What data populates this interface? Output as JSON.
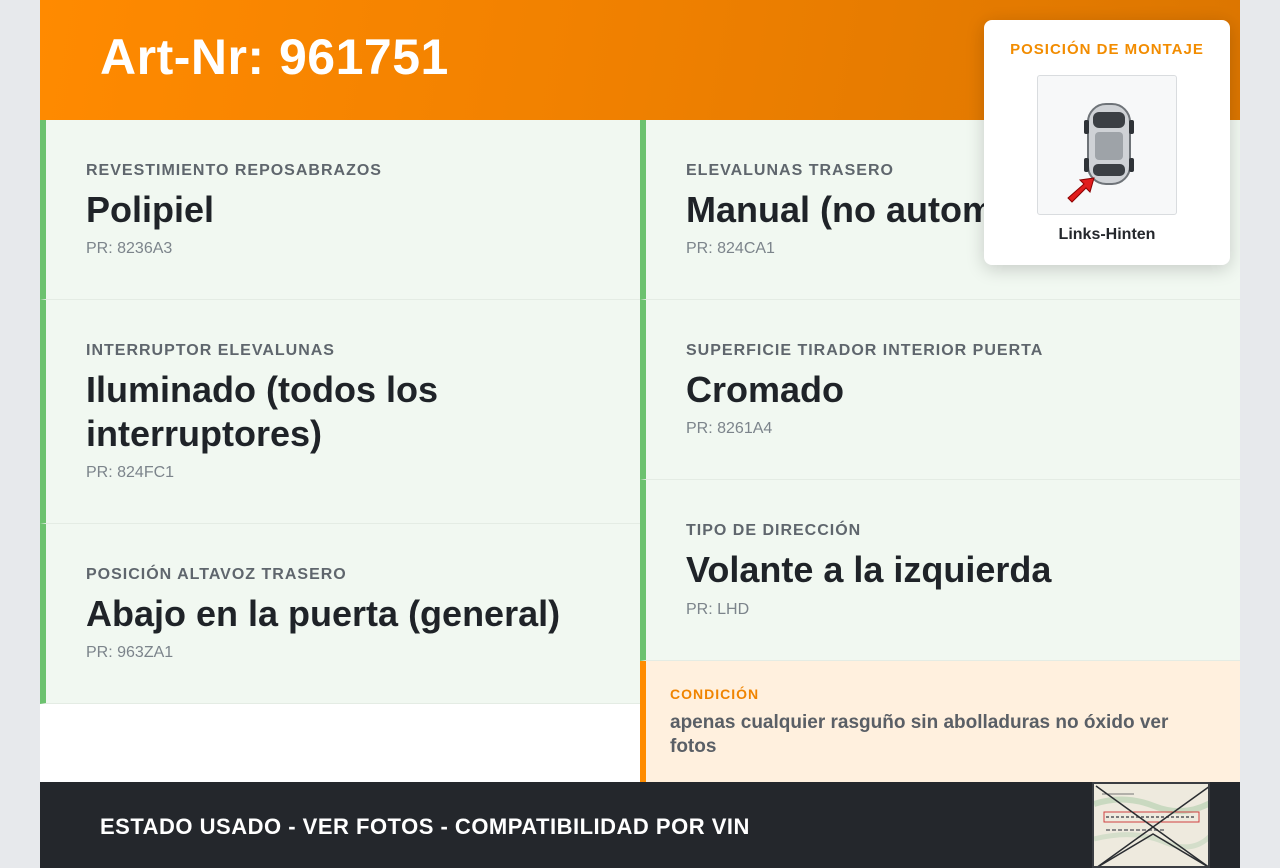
{
  "header": {
    "title": "Art-Nr: 961751"
  },
  "specs_left": [
    {
      "label": "REVESTIMIENTO REPOSABRAZOS",
      "value": "Polipiel",
      "pr": "PR: 8236A3"
    },
    {
      "label": "INTERRUPTOR ELEVALUNAS",
      "value": "Iluminado (todos los interruptores)",
      "pr": "PR: 824FC1"
    },
    {
      "label": "POSICIÓN ALTAVOZ TRASERO",
      "value": "Abajo en la puerta (general)",
      "pr": "PR: 963ZA1"
    }
  ],
  "specs_right": [
    {
      "label": "ELEVALUNAS TRASERO",
      "value": "Manual (no autom",
      "pr": "PR: 824CA1"
    },
    {
      "label": "SUPERFICIE TIRADOR INTERIOR PUERTA",
      "value": "Cromado",
      "pr": "PR: 8261A4"
    },
    {
      "label": "TIPO DE DIRECCIÓN",
      "value": "Volante a la izquierda",
      "pr": "PR: LHD"
    }
  ],
  "condition": {
    "label": "CONDICIÓN",
    "text": "apenas cualquier rasguño sin abolladuras no óxido ver fotos"
  },
  "mounting": {
    "title": "POSICIÓN DE MONTAJE",
    "position": "Links-Hinten",
    "icon": "car-top-view-icon"
  },
  "footer": {
    "text": "ESTADO USADO - VER FOTOS - COMPATIBILIDAD POR VIN",
    "thumbnail": "document-thumbnail"
  },
  "colors": {
    "brand_orange": "#ff8a00",
    "accent_green": "#6cc26f",
    "card_bg": "#f1f8f1",
    "condition_bg": "#fff0de",
    "footer_bg": "#24272c"
  }
}
